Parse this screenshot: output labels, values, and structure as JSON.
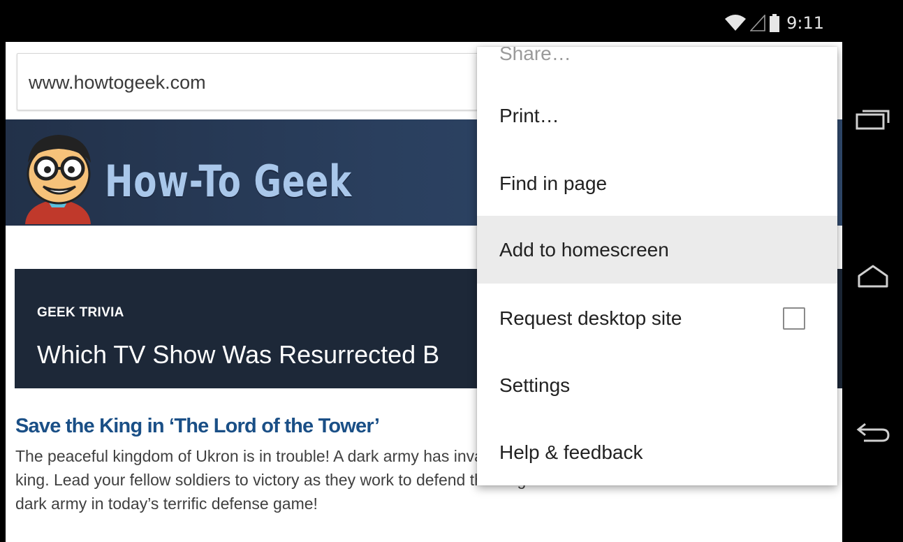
{
  "status_bar": {
    "time": "9:11",
    "icons": [
      "wifi-icon",
      "signal-icon",
      "battery-icon"
    ]
  },
  "browser": {
    "url": "www.howtogeek.com"
  },
  "site": {
    "logo_text": "How-To Geek",
    "trivia_label": "GEEK TRIVIA",
    "trivia_title": "Which TV Show Was Resurrected B",
    "game_title": "Save the King in ‘The Lord of the Tower’",
    "game_description": "The peaceful kingdom of Ukron is in trouble! A dark army has invaded the kingdom and seeks to dethrone the king. Lead your fellow soldiers to victory as they work to defend the king and save Ukron from the minions of the dark army in today’s terrific defense game!"
  },
  "menu": {
    "items": [
      {
        "label": "Share…"
      },
      {
        "label": "Print…"
      },
      {
        "label": "Find in page"
      },
      {
        "label": "Add to homescreen"
      },
      {
        "label": "Request desktop site",
        "checked": false
      },
      {
        "label": "Settings"
      },
      {
        "label": "Help & feedback"
      }
    ]
  },
  "nav_bar": {
    "buttons": [
      "recent-apps-icon",
      "home-icon",
      "back-icon"
    ]
  },
  "colors": {
    "banner": "#2a3f5e",
    "trivia_bg": "#1d2838",
    "link": "#1a4f86",
    "menu_highlight": "#ebebeb"
  }
}
